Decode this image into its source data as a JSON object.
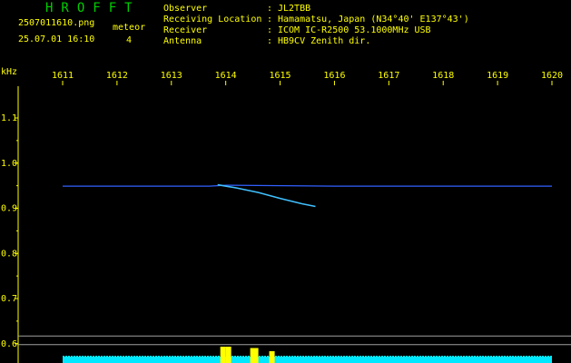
{
  "header": {
    "app_title": "HROFFT",
    "file_name": "2507011610.png",
    "timestamp": "25.07.01 16:10",
    "meteor_label": "meteor",
    "meteor_count": "4"
  },
  "metadata": [
    {
      "key": "Observer",
      "sep": ":",
      "value": "JL2TBB"
    },
    {
      "key": "Receiving Location",
      "sep": ":",
      "value": "Hamamatsu, Japan (N34°40' E137°43')"
    },
    {
      "key": "Receiver",
      "sep": ":",
      "value": "ICOM IC-R2500 53.1000MHz USB"
    },
    {
      "key": "Antenna",
      "sep": ":",
      "value": "HB9CV Zenith dir."
    }
  ],
  "colors": {
    "background": "#000000",
    "text": "#ffff00",
    "title": "#00d000",
    "trace": "#3060ff",
    "meteor": "#40c0ff",
    "noise_floor": "#00e8ff",
    "noise_spike": "#ffff00",
    "reference_line": "#a0a0a0"
  },
  "chart_data": {
    "type": "line",
    "title": "",
    "xlabel": "",
    "ylabel": "kHz",
    "x_tick_labels": [
      "1611",
      "1612",
      "1613",
      "1614",
      "1615",
      "1616",
      "1617",
      "1618",
      "1619",
      "1620"
    ],
    "y_tick_labels": [
      "1.1",
      "1.0",
      "0.9",
      "0.8",
      "0.7",
      "0.6"
    ],
    "xlim": [
      1610.7,
      1620.1
    ],
    "ylim": [
      0.57,
      1.18
    ],
    "grid": false,
    "series": [
      {
        "kind": "carrier",
        "x": [
          1611.0,
          1613.7,
          1614.0,
          1616.0,
          1620.0
        ],
        "y": [
          0.949,
          0.949,
          0.951,
          0.949,
          0.949
        ]
      },
      {
        "kind": "meteor",
        "x": [
          1613.85,
          1614.2,
          1614.6,
          1615.0,
          1615.4,
          1615.65
        ],
        "y": [
          0.952,
          0.945,
          0.935,
          0.922,
          0.91,
          0.904
        ]
      }
    ],
    "reference_lines": [
      0.617,
      0.598
    ],
    "noise_floor": {
      "x_range": [
        1611.0,
        1620.0
      ],
      "level": 0.5,
      "spikes": [
        {
          "x": 1613.95,
          "height": 1.0
        },
        {
          "x": 1614.05,
          "height": 1.0
        },
        {
          "x": 1614.5,
          "height": 0.85
        },
        {
          "x": 1614.55,
          "height": 0.85
        },
        {
          "x": 1614.85,
          "height": 0.5
        }
      ]
    }
  }
}
